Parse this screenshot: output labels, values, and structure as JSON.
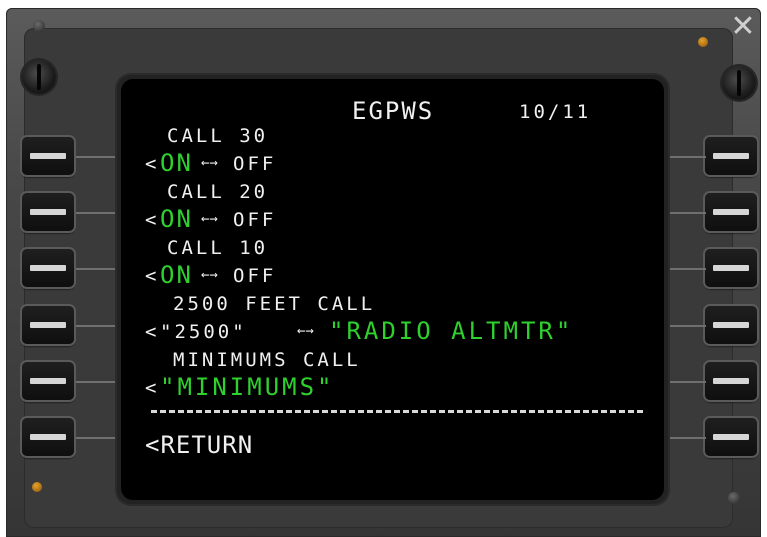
{
  "page": {
    "title": "EGPWS",
    "page_indicator": "10/11"
  },
  "options": [
    {
      "heading": "CALL 30",
      "prefix": "<",
      "selected": "ON",
      "arrows": "←→",
      "alternate": "OFF"
    },
    {
      "heading": "CALL 20",
      "prefix": "<",
      "selected": "ON",
      "arrows": "←→",
      "alternate": "OFF"
    },
    {
      "heading": "CALL 10",
      "prefix": "<",
      "selected": "ON",
      "arrows": "←→",
      "alternate": "OFF"
    },
    {
      "heading": "2500 FEET CALL",
      "prefix": "<",
      "alternate": "\"2500\"",
      "arrows": "←→",
      "selected": "\"RADIO ALTMTR\""
    },
    {
      "heading": "MINIMUMS CALL",
      "prefix": "<",
      "selected": "\"MINIMUMS\""
    }
  ],
  "separator": "------------------------",
  "return_label": "<RETURN",
  "colors": {
    "text_white": "#f0f0f0",
    "text_green": "#2fd12f",
    "screen_bg": "#000000",
    "bezel": "#474747"
  },
  "icons": {
    "close": "close-icon",
    "knob_left": "brightness-knob-icon",
    "knob_right": "brightness-knob-icon"
  }
}
